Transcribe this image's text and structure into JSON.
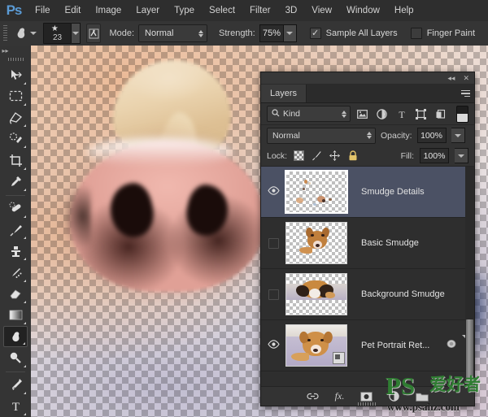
{
  "app": {
    "logo": "Ps",
    "menus": [
      "File",
      "Edit",
      "Image",
      "Layer",
      "Type",
      "Select",
      "Filter",
      "3D",
      "View",
      "Window",
      "Help"
    ]
  },
  "options_bar": {
    "tool_icon": "smudge-tool-icon",
    "brush_size": "23",
    "brush_panel_icon": "brush-panel-icon",
    "mode_label": "Mode:",
    "mode_value": "Normal",
    "strength_label": "Strength:",
    "strength_value": "75%",
    "sample_all_layers_label": "Sample All Layers",
    "sample_all_layers_checked": true,
    "sample_all_layers_mark": "✓",
    "finger_paint_label": "Finger Paint",
    "finger_paint_checked": false
  },
  "toolbar": {
    "collapse_label": "▸▸",
    "tools": [
      {
        "name": "move-tool",
        "glyph": "move"
      },
      {
        "name": "rectangular-marquee-tool",
        "glyph": "marquee"
      },
      {
        "name": "lasso-tool",
        "glyph": "lasso"
      },
      {
        "name": "quick-selection-tool",
        "glyph": "quickselect"
      },
      {
        "name": "crop-tool",
        "glyph": "crop"
      },
      {
        "name": "eyedropper-tool",
        "glyph": "eyedropper"
      },
      {
        "name": "spot-healing-brush-tool",
        "glyph": "healing"
      },
      {
        "name": "brush-tool",
        "glyph": "brush"
      },
      {
        "name": "clone-stamp-tool",
        "glyph": "stamp"
      },
      {
        "name": "history-brush-tool",
        "glyph": "historybrush"
      },
      {
        "name": "eraser-tool",
        "glyph": "eraser"
      },
      {
        "name": "gradient-tool",
        "glyph": "gradient"
      },
      {
        "name": "smudge-tool",
        "glyph": "smudge",
        "active": true
      },
      {
        "name": "dodge-tool",
        "glyph": "dodge"
      },
      {
        "name": "pen-tool",
        "glyph": "pen"
      },
      {
        "name": "horizontal-type-tool",
        "glyph": "type"
      }
    ]
  },
  "layers_panel": {
    "collapse_icon": "◂◂",
    "close_icon": "✕",
    "tab_label": "Layers",
    "filter": {
      "kind_label": "Kind",
      "search_icon": "search-icon",
      "icons": [
        "pixel-filter-icon",
        "adjustment-filter-icon",
        "type-filter-icon",
        "shape-filter-icon",
        "smart-object-filter-icon"
      ],
      "toggle_name": "filter-enable-toggle"
    },
    "blend_mode": "Normal",
    "opacity_label": "Opacity:",
    "opacity_value": "100%",
    "lock_label": "Lock:",
    "lock_icons": [
      "lock-transparent-pixels-icon",
      "lock-image-pixels-icon",
      "lock-position-icon",
      "lock-all-icon"
    ],
    "fill_label": "Fill:",
    "fill_value": "100%",
    "layers": [
      {
        "name": "Smudge Details",
        "visible": true,
        "selected": true,
        "thumb": "smudge-details-thumbnail",
        "thumb_kind": "specks"
      },
      {
        "name": "Basic Smudge",
        "visible": false,
        "selected": false,
        "thumb": "basic-smudge-thumbnail",
        "thumb_kind": "dog-head"
      },
      {
        "name": "Background Smudge",
        "visible": false,
        "selected": false,
        "thumb": "background-smudge-thumbnail",
        "thumb_kind": "dog-lying"
      },
      {
        "name": "Pet Portrait Ret...",
        "visible": true,
        "selected": false,
        "thumb": "pet-portrait-thumbnail",
        "thumb_kind": "dog-photo",
        "has_smart_badge": true,
        "has_fx_icon": true
      }
    ],
    "footer_icons": [
      "link-layers-icon",
      "add-layer-style-icon",
      "add-layer-mask-icon",
      "new-adjustment-layer-icon",
      "new-group-icon"
    ],
    "footer_fx_label": "fx."
  },
  "watermark": {
    "logo": "PS",
    "chinese": "爱好者",
    "url": "www.psahz.com"
  }
}
